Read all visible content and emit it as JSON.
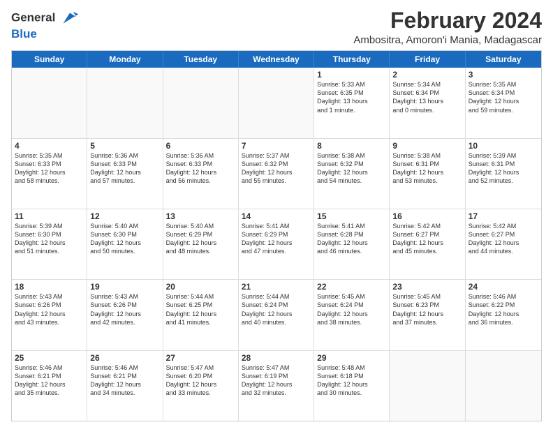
{
  "header": {
    "logo_line1": "General",
    "logo_line2": "Blue",
    "title": "February 2024",
    "subtitle": "Ambositra, Amoron'i Mania, Madagascar"
  },
  "days": [
    "Sunday",
    "Monday",
    "Tuesday",
    "Wednesday",
    "Thursday",
    "Friday",
    "Saturday"
  ],
  "rows": [
    [
      {
        "day": "",
        "text": ""
      },
      {
        "day": "",
        "text": ""
      },
      {
        "day": "",
        "text": ""
      },
      {
        "day": "",
        "text": ""
      },
      {
        "day": "1",
        "text": "Sunrise: 5:33 AM\nSunset: 6:35 PM\nDaylight: 13 hours\nand 1 minute."
      },
      {
        "day": "2",
        "text": "Sunrise: 5:34 AM\nSunset: 6:34 PM\nDaylight: 13 hours\nand 0 minutes."
      },
      {
        "day": "3",
        "text": "Sunrise: 5:35 AM\nSunset: 6:34 PM\nDaylight: 12 hours\nand 59 minutes."
      }
    ],
    [
      {
        "day": "4",
        "text": "Sunrise: 5:35 AM\nSunset: 6:33 PM\nDaylight: 12 hours\nand 58 minutes."
      },
      {
        "day": "5",
        "text": "Sunrise: 5:36 AM\nSunset: 6:33 PM\nDaylight: 12 hours\nand 57 minutes."
      },
      {
        "day": "6",
        "text": "Sunrise: 5:36 AM\nSunset: 6:33 PM\nDaylight: 12 hours\nand 56 minutes."
      },
      {
        "day": "7",
        "text": "Sunrise: 5:37 AM\nSunset: 6:32 PM\nDaylight: 12 hours\nand 55 minutes."
      },
      {
        "day": "8",
        "text": "Sunrise: 5:38 AM\nSunset: 6:32 PM\nDaylight: 12 hours\nand 54 minutes."
      },
      {
        "day": "9",
        "text": "Sunrise: 5:38 AM\nSunset: 6:31 PM\nDaylight: 12 hours\nand 53 minutes."
      },
      {
        "day": "10",
        "text": "Sunrise: 5:39 AM\nSunset: 6:31 PM\nDaylight: 12 hours\nand 52 minutes."
      }
    ],
    [
      {
        "day": "11",
        "text": "Sunrise: 5:39 AM\nSunset: 6:30 PM\nDaylight: 12 hours\nand 51 minutes."
      },
      {
        "day": "12",
        "text": "Sunrise: 5:40 AM\nSunset: 6:30 PM\nDaylight: 12 hours\nand 50 minutes."
      },
      {
        "day": "13",
        "text": "Sunrise: 5:40 AM\nSunset: 6:29 PM\nDaylight: 12 hours\nand 48 minutes."
      },
      {
        "day": "14",
        "text": "Sunrise: 5:41 AM\nSunset: 6:29 PM\nDaylight: 12 hours\nand 47 minutes."
      },
      {
        "day": "15",
        "text": "Sunrise: 5:41 AM\nSunset: 6:28 PM\nDaylight: 12 hours\nand 46 minutes."
      },
      {
        "day": "16",
        "text": "Sunrise: 5:42 AM\nSunset: 6:27 PM\nDaylight: 12 hours\nand 45 minutes."
      },
      {
        "day": "17",
        "text": "Sunrise: 5:42 AM\nSunset: 6:27 PM\nDaylight: 12 hours\nand 44 minutes."
      }
    ],
    [
      {
        "day": "18",
        "text": "Sunrise: 5:43 AM\nSunset: 6:26 PM\nDaylight: 12 hours\nand 43 minutes."
      },
      {
        "day": "19",
        "text": "Sunrise: 5:43 AM\nSunset: 6:26 PM\nDaylight: 12 hours\nand 42 minutes."
      },
      {
        "day": "20",
        "text": "Sunrise: 5:44 AM\nSunset: 6:25 PM\nDaylight: 12 hours\nand 41 minutes."
      },
      {
        "day": "21",
        "text": "Sunrise: 5:44 AM\nSunset: 6:24 PM\nDaylight: 12 hours\nand 40 minutes."
      },
      {
        "day": "22",
        "text": "Sunrise: 5:45 AM\nSunset: 6:24 PM\nDaylight: 12 hours\nand 38 minutes."
      },
      {
        "day": "23",
        "text": "Sunrise: 5:45 AM\nSunset: 6:23 PM\nDaylight: 12 hours\nand 37 minutes."
      },
      {
        "day": "24",
        "text": "Sunrise: 5:46 AM\nSunset: 6:22 PM\nDaylight: 12 hours\nand 36 minutes."
      }
    ],
    [
      {
        "day": "25",
        "text": "Sunrise: 5:46 AM\nSunset: 6:21 PM\nDaylight: 12 hours\nand 35 minutes."
      },
      {
        "day": "26",
        "text": "Sunrise: 5:46 AM\nSunset: 6:21 PM\nDaylight: 12 hours\nand 34 minutes."
      },
      {
        "day": "27",
        "text": "Sunrise: 5:47 AM\nSunset: 6:20 PM\nDaylight: 12 hours\nand 33 minutes."
      },
      {
        "day": "28",
        "text": "Sunrise: 5:47 AM\nSunset: 6:19 PM\nDaylight: 12 hours\nand 32 minutes."
      },
      {
        "day": "29",
        "text": "Sunrise: 5:48 AM\nSunset: 6:18 PM\nDaylight: 12 hours\nand 30 minutes."
      },
      {
        "day": "",
        "text": ""
      },
      {
        "day": "",
        "text": ""
      }
    ]
  ]
}
